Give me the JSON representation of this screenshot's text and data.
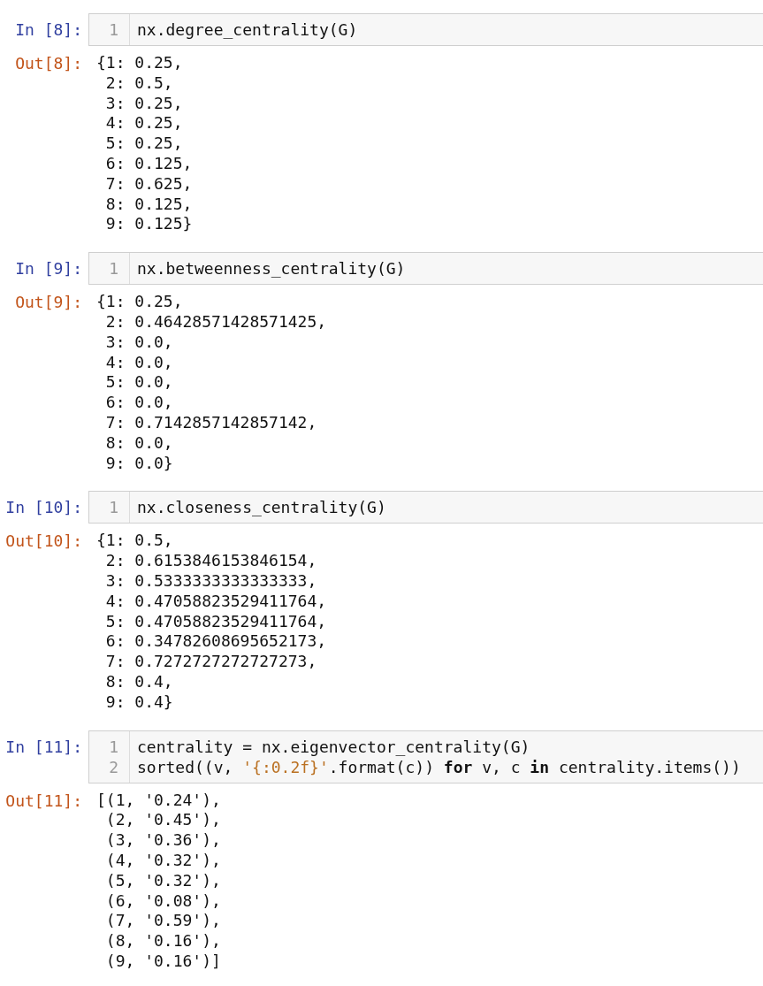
{
  "cells": [
    {
      "in_prompt": "In [8]:",
      "code": [
        {
          "number": "1",
          "tokens": [
            {
              "kind": "plain",
              "text": "nx.degree_centrality(G)"
            }
          ]
        }
      ],
      "out_prompt": "Out[8]:",
      "output": [
        "{1: 0.25,",
        " 2: 0.5,",
        " 3: 0.25,",
        " 4: 0.25,",
        " 5: 0.25,",
        " 6: 0.125,",
        " 7: 0.625,",
        " 8: 0.125,",
        " 9: 0.125}"
      ]
    },
    {
      "in_prompt": "In [9]:",
      "code": [
        {
          "number": "1",
          "tokens": [
            {
              "kind": "plain",
              "text": "nx.betweenness_centrality(G)"
            }
          ]
        }
      ],
      "out_prompt": "Out[9]:",
      "output": [
        "{1: 0.25,",
        " 2: 0.46428571428571425,",
        " 3: 0.0,",
        " 4: 0.0,",
        " 5: 0.0,",
        " 6: 0.0,",
        " 7: 0.7142857142857142,",
        " 8: 0.0,",
        " 9: 0.0}"
      ]
    },
    {
      "in_prompt": "In [10]:",
      "code": [
        {
          "number": "1",
          "tokens": [
            {
              "kind": "plain",
              "text": "nx.closeness_centrality(G)"
            }
          ]
        }
      ],
      "out_prompt": "Out[10]:",
      "output": [
        "{1: 0.5,",
        " 2: 0.6153846153846154,",
        " 3: 0.5333333333333333,",
        " 4: 0.47058823529411764,",
        " 5: 0.47058823529411764,",
        " 6: 0.34782608695652173,",
        " 7: 0.7272727272727273,",
        " 8: 0.4,",
        " 9: 0.4}"
      ]
    },
    {
      "in_prompt": "In [11]:",
      "code": [
        {
          "number": "1",
          "tokens": [
            {
              "kind": "plain",
              "text": "centrality = nx.eigenvector_centrality(G)"
            }
          ]
        },
        {
          "number": "2",
          "tokens": [
            {
              "kind": "plain",
              "text": "sorted((v, "
            },
            {
              "kind": "string",
              "text": "'{:0.2f}'"
            },
            {
              "kind": "plain",
              "text": ".format(c)) "
            },
            {
              "kind": "keyword",
              "text": "for"
            },
            {
              "kind": "plain",
              "text": " v, c "
            },
            {
              "kind": "keyword",
              "text": "in"
            },
            {
              "kind": "plain",
              "text": " centrality.items())"
            }
          ]
        }
      ],
      "out_prompt": "Out[11]:",
      "output": [
        "[(1, '0.24'),",
        " (2, '0.45'),",
        " (3, '0.36'),",
        " (4, '0.32'),",
        " (5, '0.32'),",
        " (6, '0.08'),",
        " (7, '0.59'),",
        " (8, '0.16'),",
        " (9, '0.16')]"
      ]
    }
  ]
}
